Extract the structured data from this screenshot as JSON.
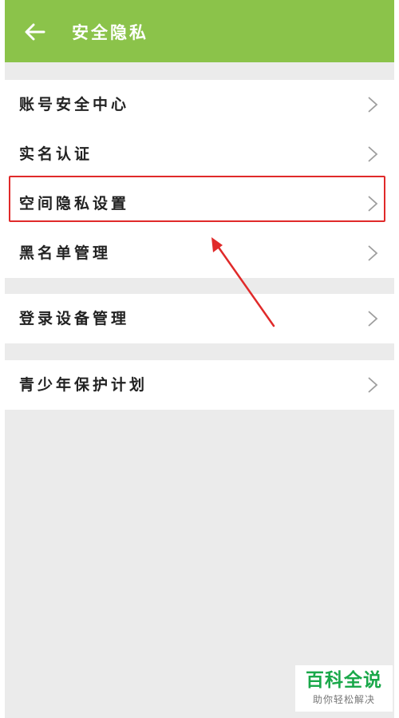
{
  "header": {
    "title": "安全隐私",
    "back_icon": "arrow-left-icon",
    "background": "#8bc34a"
  },
  "groups": [
    {
      "items": [
        {
          "label": "账号安全中心",
          "icon": "chevron-right-icon"
        },
        {
          "label": "实名认证",
          "icon": "chevron-right-icon"
        },
        {
          "label": "空间隐私设置",
          "icon": "chevron-right-icon",
          "highlighted": true
        },
        {
          "label": "黑名单管理",
          "icon": "chevron-right-icon"
        }
      ]
    },
    {
      "items": [
        {
          "label": "登录设备管理",
          "icon": "chevron-right-icon"
        }
      ]
    },
    {
      "items": [
        {
          "label": "青少年保护计划",
          "icon": "chevron-right-icon"
        }
      ]
    }
  ],
  "annotation": {
    "highlight_color": "#e02a2a",
    "arrow_icon": "red-arrow-icon"
  },
  "watermark": {
    "main": "百科全说",
    "sub": "助你轻松解决",
    "color": "#1aa84a"
  }
}
